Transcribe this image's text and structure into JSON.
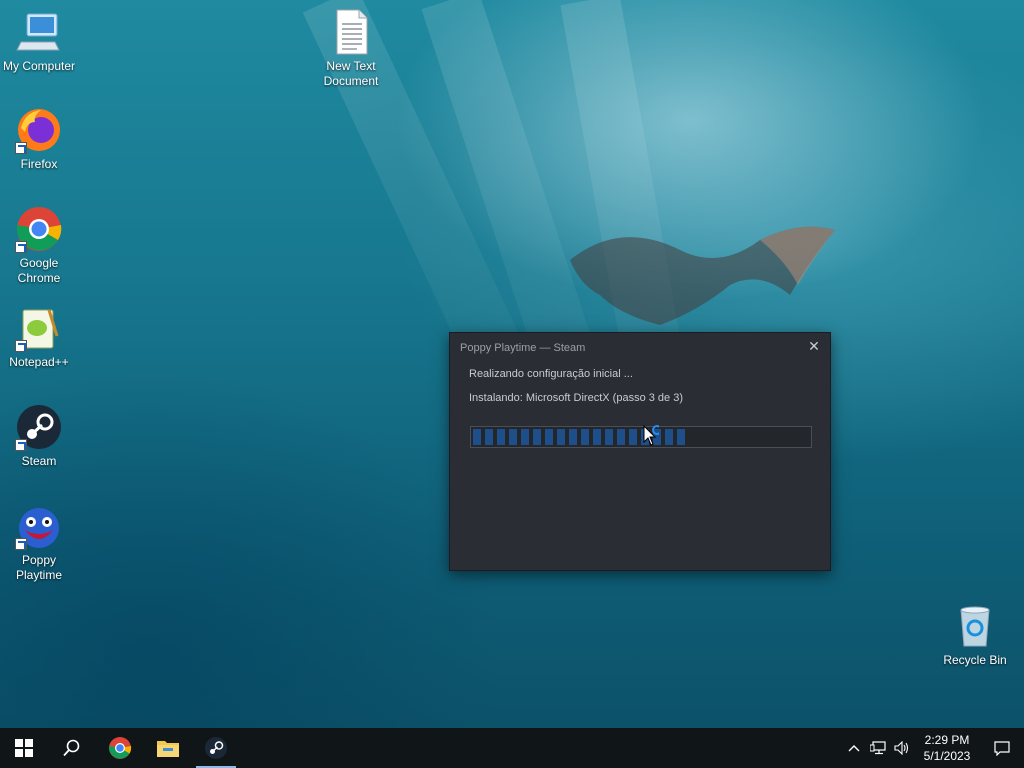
{
  "desktop": {
    "icons": [
      {
        "label": "My Computer"
      },
      {
        "label": "New Text Document"
      },
      {
        "label": "Firefox"
      },
      {
        "label": "Google Chrome"
      },
      {
        "label": "Notepad++"
      },
      {
        "label": "Steam"
      },
      {
        "label": "Poppy Playtime"
      },
      {
        "label": "Recycle Bin"
      }
    ]
  },
  "dialog": {
    "title": "Poppy Playtime — Steam",
    "close_symbol": "✕",
    "status": "Realizando configuração inicial ...",
    "step": "Instalando: Microsoft DirectX (passo 3 de 3)",
    "progress_fraction": 0.64,
    "accent": "#1e4f8a"
  },
  "taskbar": {
    "buttons": [
      {
        "icon": "windows-start-icon"
      },
      {
        "icon": "search-icon"
      },
      {
        "icon": "chrome-icon"
      },
      {
        "icon": "file-explorer-icon"
      },
      {
        "icon": "steam-icon"
      }
    ],
    "time": "2:29 PM",
    "date": "5/1/2023"
  }
}
